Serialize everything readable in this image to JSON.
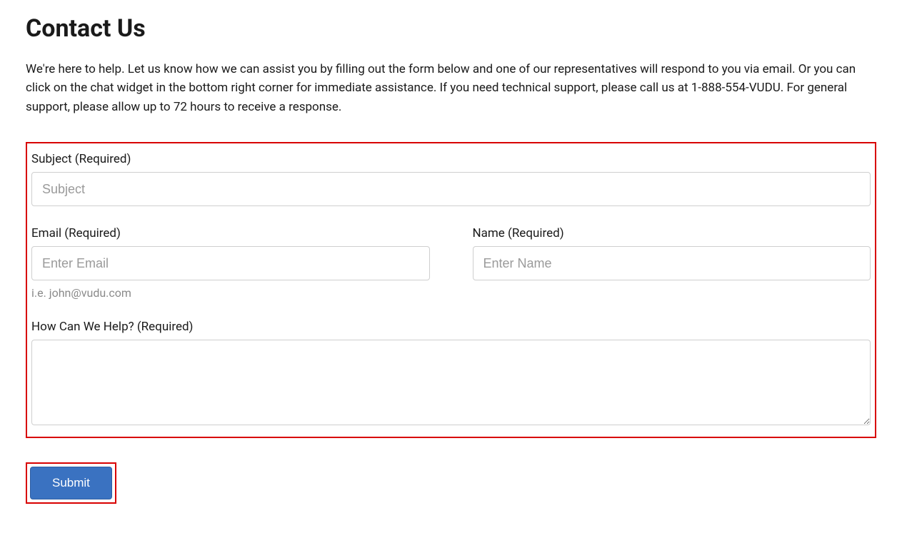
{
  "title": "Contact Us",
  "intro": "We're here to help. Let us know how we can assist you by filling out the form below and one of our representatives will respond to you via email. Or you can click on the chat widget in the bottom right corner for immediate assistance. If you need technical support, please call us at 1-888-554-VUDU. For general support, please allow up to 72 hours to receive a response.",
  "form": {
    "subject": {
      "label": "Subject (Required)",
      "placeholder": "Subject",
      "value": ""
    },
    "email": {
      "label": "Email (Required)",
      "placeholder": "Enter Email",
      "help": "i.e. john@vudu.com",
      "value": ""
    },
    "name": {
      "label": "Name (Required)",
      "placeholder": "Enter Name",
      "value": ""
    },
    "message": {
      "label": "How Can We Help? (Required)",
      "value": ""
    },
    "submit_label": "Submit"
  }
}
